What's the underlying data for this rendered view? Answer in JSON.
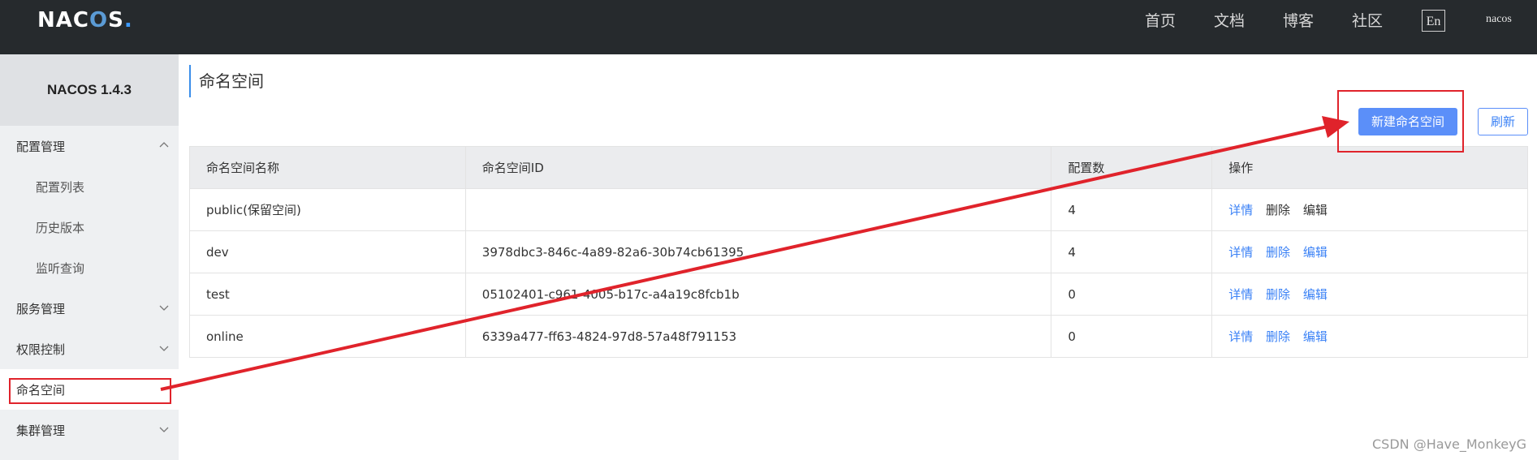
{
  "header": {
    "logo": {
      "text_pre": "NAC",
      "text_o": "O",
      "text_post": "S",
      "dot": "."
    },
    "nav": [
      "首页",
      "文档",
      "博客",
      "社区"
    ],
    "lang_button": "En",
    "user": "nacos"
  },
  "sidebar": {
    "title": "NACOS 1.4.3",
    "items": [
      {
        "label": "配置管理",
        "icon": "chevron-up-icon"
      },
      {
        "label": "配置列表"
      },
      {
        "label": "历史版本"
      },
      {
        "label": "监听查询"
      },
      {
        "label": "服务管理",
        "icon": "chevron-down-icon"
      },
      {
        "label": "权限控制",
        "icon": "chevron-down-icon"
      },
      {
        "label": "命名空间",
        "active": true
      },
      {
        "label": "集群管理",
        "icon": "chevron-down-icon"
      }
    ]
  },
  "main": {
    "page_title": "命名空间",
    "new_button": "新建命名空间",
    "refresh_button": "刷新",
    "table": {
      "columns": [
        "命名空间名称",
        "命名空间ID",
        "配置数",
        "操作"
      ],
      "rows": [
        {
          "name": "public(保留空间)",
          "id": "",
          "count": "4",
          "actions": [
            "详情",
            "删除",
            "编辑"
          ]
        },
        {
          "name": "dev",
          "id": "3978dbc3-846c-4a89-82a6-30b74cb61395",
          "count": "4",
          "actions": [
            "详情",
            "删除",
            "编辑"
          ]
        },
        {
          "name": "test",
          "id": "05102401-c961-4005-b17c-a4a19c8fcb1b",
          "count": "0",
          "actions": [
            "详情",
            "删除",
            "编辑"
          ]
        },
        {
          "name": "online",
          "id": "6339a477-ff63-4824-97d8-57a48f791153",
          "count": "0",
          "actions": [
            "详情",
            "删除",
            "编辑"
          ]
        }
      ]
    }
  },
  "watermark": "CSDN @Have_MonkeyG",
  "colors": {
    "annotation": "#e0232b",
    "primary": "#5b8ff9",
    "header_bg": "#262a2d"
  }
}
